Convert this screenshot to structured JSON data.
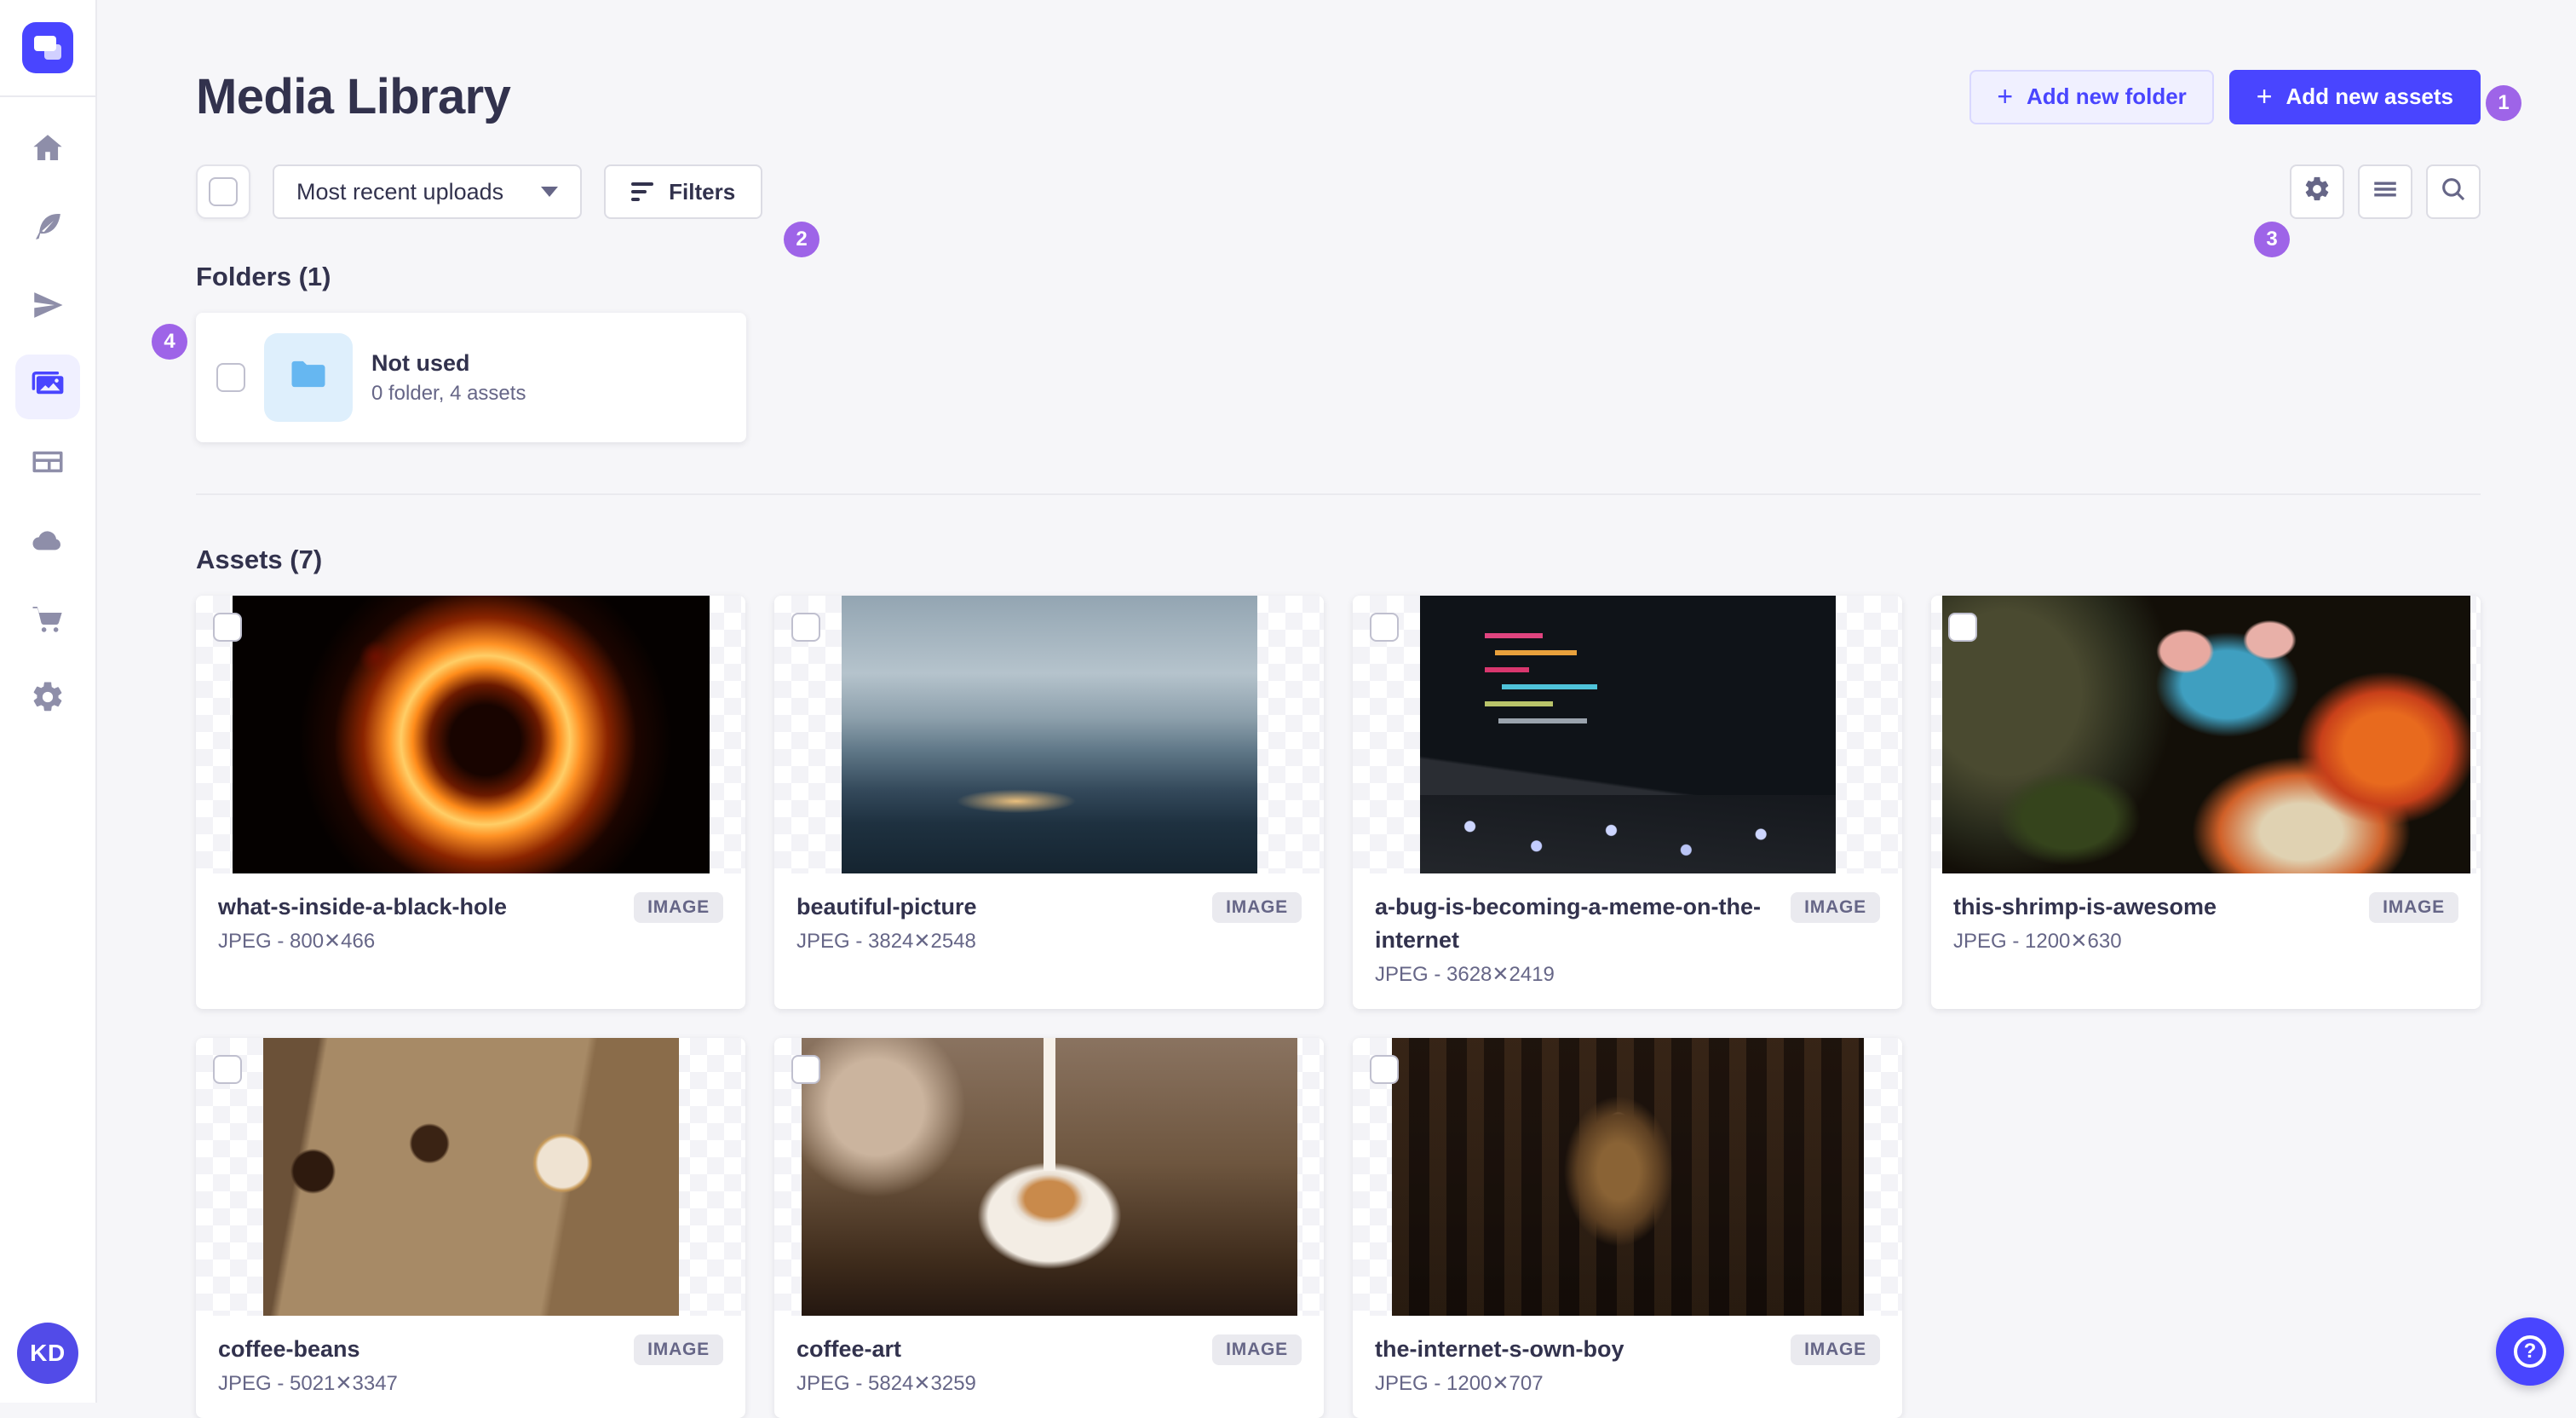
{
  "app": {
    "title": "Media Library"
  },
  "colors": {
    "primary": "#4945ff",
    "primary_light": "#f0f0ff",
    "annotation_badge": "#9e64e8",
    "text_dark": "#32324d",
    "text_muted": "#666687",
    "folder_icon_blue": "#66b7f1",
    "page_background": "#f6f6f9"
  },
  "sidebar": {
    "logo": "strapi-logo",
    "items": [
      {
        "icon": "home",
        "active": false
      },
      {
        "icon": "feather",
        "active": false
      },
      {
        "icon": "paper-plane",
        "active": false
      },
      {
        "icon": "media-library",
        "active": true
      },
      {
        "icon": "layout",
        "active": false
      },
      {
        "icon": "cloud",
        "active": false
      },
      {
        "icon": "cart",
        "active": false
      },
      {
        "icon": "gear",
        "active": false
      }
    ],
    "avatar_initials": "KD"
  },
  "header": {
    "title": "Media Library",
    "add_folder": "Add new folder",
    "add_assets": "Add new assets",
    "plus": "+"
  },
  "toolbar": {
    "sort_value": "Most recent uploads",
    "filters": "Filters",
    "right_icons": [
      "gear",
      "list",
      "search"
    ]
  },
  "annotations": [
    {
      "n": "1"
    },
    {
      "n": "2"
    },
    {
      "n": "3"
    },
    {
      "n": "4"
    }
  ],
  "folders": {
    "heading": "Folders (1)",
    "items": [
      {
        "name": "Not used",
        "meta": "0 folder, 4 assets"
      }
    ]
  },
  "assets": {
    "heading": "Assets (7)",
    "items": [
      {
        "title": "what-s-inside-a-black-hole",
        "meta": "JPEG - 800✕466",
        "type_label": "IMAGE"
      },
      {
        "title": "beautiful-picture",
        "meta": "JPEG - 3824✕2548",
        "type_label": "IMAGE"
      },
      {
        "title": "a-bug-is-becoming-a-meme-on-the-internet",
        "meta": "JPEG - 3628✕2419",
        "type_label": "IMAGE"
      },
      {
        "title": "this-shrimp-is-awesome",
        "meta": "JPEG - 1200✕630",
        "type_label": "IMAGE"
      },
      {
        "title": "coffee-beans",
        "meta": "JPEG - 5021✕3347",
        "type_label": "IMAGE"
      },
      {
        "title": "coffee-art",
        "meta": "JPEG - 5824✕3259",
        "type_label": "IMAGE"
      },
      {
        "title": "the-internet-s-own-boy",
        "meta": "JPEG - 1200✕707",
        "type_label": "IMAGE"
      }
    ]
  },
  "fab": {
    "glyph": "?"
  }
}
